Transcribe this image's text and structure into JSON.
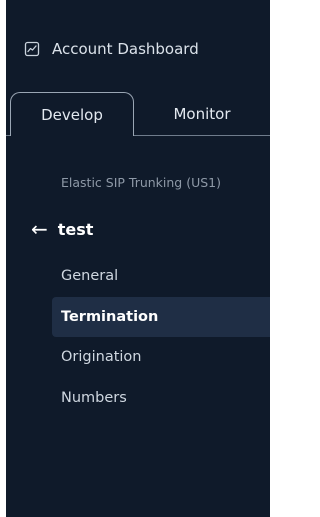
{
  "sidebar": {
    "dashboard_link": "Account Dashboard",
    "dashboard_icon": "chart-icon",
    "tabs": [
      {
        "label": "Develop",
        "selected": true
      },
      {
        "label": "Monitor",
        "selected": false
      }
    ],
    "product": "Elastic SIP Trunking (US1)",
    "back_icon": "arrow-left-icon",
    "trunk_name": "test",
    "nav": [
      {
        "label": "General",
        "active": false
      },
      {
        "label": "Termination",
        "active": true
      },
      {
        "label": "Origination",
        "active": false
      },
      {
        "label": "Numbers",
        "active": false
      }
    ]
  },
  "colors": {
    "sidebar_bg": "#0f1a2a",
    "active_item_bg": "#1f2e45",
    "text": "#d6dde6",
    "muted_text": "#8e99a7"
  }
}
